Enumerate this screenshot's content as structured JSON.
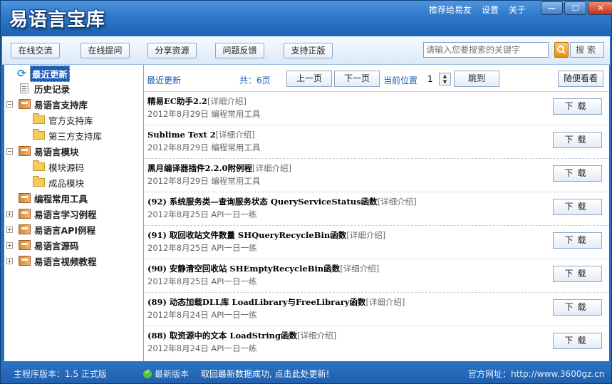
{
  "window": {
    "title": "易语言宝库",
    "top_links": [
      "推荐给易友",
      "设置",
      "关于"
    ],
    "controls": [
      "—",
      "☐",
      "✕"
    ]
  },
  "toolbar": {
    "buttons": [
      "在线交流",
      "在线提问",
      "分享资源",
      "问题反馈",
      "支持正版"
    ],
    "search_placeholder": "请输入您要搜索的关键字",
    "search_label": "搜索"
  },
  "tree": [
    {
      "label": "最近更新",
      "icon": "refresh-icon"
    },
    {
      "label": "历史记录",
      "icon": "history-icon"
    },
    {
      "label": "易语言支持库",
      "icon": "book-icon"
    },
    {
      "label": "官方支持库",
      "icon": "folder-icon"
    },
    {
      "label": "第三方支持库",
      "icon": "folder-icon"
    },
    {
      "label": "易语言模块",
      "icon": "book-icon"
    },
    {
      "label": "模块源码",
      "icon": "folder-icon"
    },
    {
      "label": "成品模块",
      "icon": "folder-icon"
    },
    {
      "label": "编程常用工具",
      "icon": "book-icon"
    },
    {
      "label": "易语言学习例程",
      "icon": "book-icon"
    },
    {
      "label": "易语言API例程",
      "icon": "book-icon"
    },
    {
      "label": "易语言源码",
      "icon": "book-icon"
    },
    {
      "label": "易语言视频教程",
      "icon": "book-icon"
    }
  ],
  "content_header": {
    "section": "最近更新",
    "total": "共：6页",
    "prev": "上一页",
    "next": "下一页",
    "position_label": "当前位置",
    "page": "1",
    "jump": "跳到",
    "random": "随便看看"
  },
  "items": [
    {
      "title": "精易EC助手2.2",
      "detail": "[详细介绍]",
      "date": "2012年8月29日",
      "category": "编程常用工具",
      "download": "下载"
    },
    {
      "title": "Sublime Text 2",
      "detail": "[详细介绍]",
      "date": "2012年8月29日",
      "category": "编程常用工具",
      "download": "下载"
    },
    {
      "title": "黑月编译器插件2.2.0附例程",
      "detail": "[详细介绍]",
      "date": "2012年8月29日",
      "category": "编程常用工具",
      "download": "下载"
    },
    {
      "title": "(92) 系统服务类—查询服务状态  QueryServiceStatus函数",
      "detail": "[详细介绍]",
      "date": "2012年8月25日",
      "category": "API一日一练",
      "download": "下载"
    },
    {
      "title": "(91) 取回收站文件数量  SHQueryRecycleBin函数",
      "detail": "[详细介绍]",
      "date": "2012年8月25日",
      "category": "API一日一练",
      "download": "下载"
    },
    {
      "title": "(90) 安静清空回收站  SHEmptyRecycleBin函数",
      "detail": "[详细介绍]",
      "date": "2012年8月25日",
      "category": "API一日一练",
      "download": "下载"
    },
    {
      "title": "(89) 动态加载DLL库  LoadLibrary与FreeLibrary函数",
      "detail": "[详细介绍]",
      "date": "2012年8月24日",
      "category": "API一日一练",
      "download": "下载"
    },
    {
      "title": "(88) 取资源中的文本  LoadString函数",
      "detail": "[详细介绍]",
      "date": "2012年8月24日",
      "category": "API一日一练",
      "download": "下载"
    }
  ],
  "status": {
    "version": "主程序版本：1.5 正式版",
    "latest": "最新版本",
    "message": "取回最新数据成功, 点击此处更新!",
    "site": "官方网址：http://www.3600gz.cn"
  }
}
